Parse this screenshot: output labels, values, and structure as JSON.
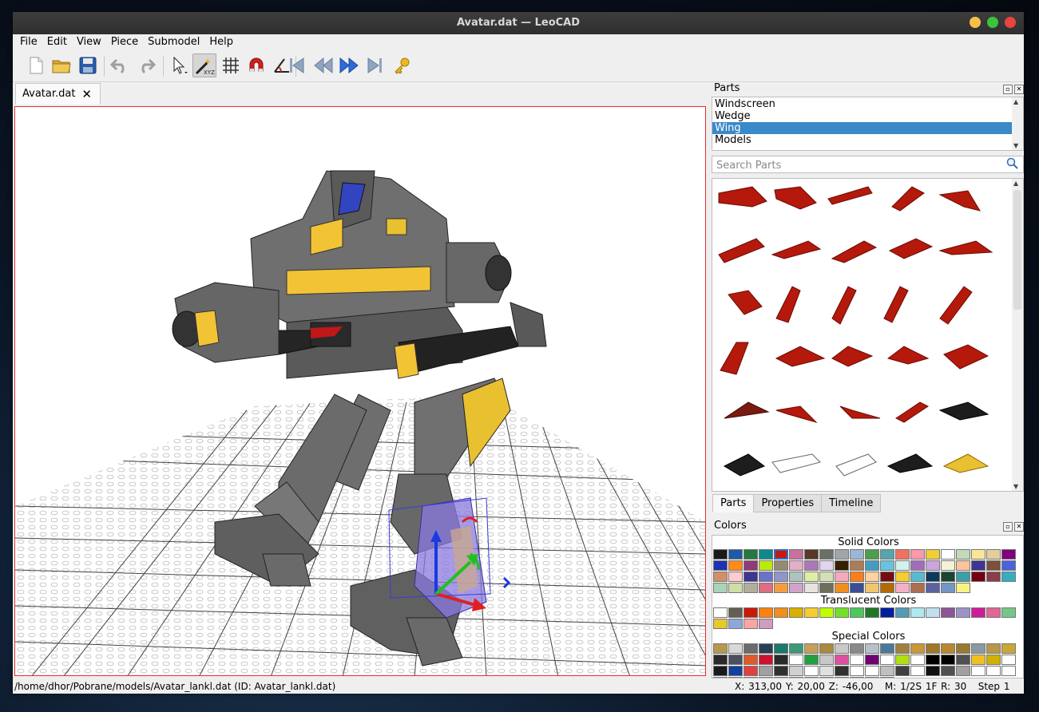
{
  "window": {
    "title": "Avatar.dat — LeoCAD"
  },
  "menu": [
    "File",
    "Edit",
    "View",
    "Piece",
    "Submodel",
    "Help"
  ],
  "toolbar": {
    "buttons": [
      "new-file-icon",
      "open-folder-icon",
      "save-icon",
      "undo-icon",
      "redo-icon",
      "select-tool-icon",
      "transform-tool-icon",
      "grid-snap-icon",
      "magnet-snap-icon",
      "angle-snap-icon",
      "first-step-icon",
      "previous-step-icon",
      "next-step-icon",
      "last-step-icon",
      "key-icon"
    ]
  },
  "document_tab": {
    "label": "Avatar.dat"
  },
  "parts_panel": {
    "title": "Parts",
    "categories": [
      "Windscreen",
      "Wedge",
      "Wing",
      "Models"
    ],
    "selected_category": "Wing",
    "search_placeholder": "Search Parts",
    "tabs": [
      "Parts",
      "Properties",
      "Timeline"
    ],
    "active_tab": "Parts"
  },
  "colors_panel": {
    "title": "Colors",
    "solid_title": "Solid Colors",
    "translucent_title": "Translucent Colors",
    "special_title": "Special Colors",
    "solid_colors": [
      "#1a1a1a",
      "#1e5aa8",
      "#237841",
      "#0a8a8f",
      "#c91a09",
      "#c870a0",
      "#583927",
      "#6c6e68",
      "#a0a5a9",
      "#9bb7d8",
      "#4b9f4a",
      "#55a5af",
      "#f2705e",
      "#fc97ac",
      "#f2cd37",
      "#ffffff",
      "#c2dab8",
      "#fbe696",
      "#e4cd9e",
      "#81007b",
      "#2032b0",
      "#fe8a18",
      "#923978",
      "#bbe90b",
      "#958a73",
      "#e4adc8",
      "#ac78ba",
      "#e1d5ed",
      "#352100",
      "#aa7d55",
      "#469bc3",
      "#68c3e2",
      "#d3f2ea",
      "#a06eb9",
      "#cda4de",
      "#f5f3d7",
      "#fcc39e",
      "#3f3691",
      "#7c503a",
      "#4c61db",
      "#d09168",
      "#feccce",
      "#3f3691",
      "#6874ca",
      "#9195ca",
      "#adc3c0",
      "#dfeea5",
      "#d3e0b6",
      "#f6a9bb",
      "#fc7e1b",
      "#fcd2a0",
      "#720e0f",
      "#f5cd2f",
      "#59b9d1",
      "#0b3a5e",
      "#184632",
      "#3d9ea7",
      "#720012",
      "#8b3d4a",
      "#36aebf",
      "#aad4b8",
      "#d0dda3",
      "#b1ae9e",
      "#e16d82",
      "#f49c3e",
      "#d1a3c9",
      "#e6e3e0",
      "#6d6e5c",
      "#f08f1c",
      "#3a4d96",
      "#f0c66e",
      "#b46a00",
      "#f4b0c6",
      "#ab6f4e",
      "#5b61a1",
      "#7396c8",
      "#f8f184"
    ],
    "translucent_colors": [
      "#ffffff",
      "#635f52",
      "#c91a09",
      "#ff800d",
      "#f08f1c",
      "#dab000",
      "#f5cd2f",
      "#c0ff00",
      "#73e02b",
      "#4cc85a",
      "#217625",
      "#0020a0",
      "#559ab7",
      "#aee9ef",
      "#c1dff0",
      "#8e5597",
      "#9b94c9",
      "#ce1d9b",
      "#df6695",
      "#76c787",
      "#e6c92a",
      "#8ba8d9",
      "#fca4a4",
      "#d09cc3"
    ],
    "special_colors": [
      "#b59a4e",
      "#d9d9d9",
      "#6b6b6b",
      "#2a3f55",
      "#1a7a6a",
      "#3a9a7a",
      "#c5a05a",
      "#a88a40",
      "#c9c9c9",
      "#8a8a8a",
      "#b8c0c8",
      "#4a7a9a",
      "#a08040",
      "#c89838",
      "#a07828",
      "#b88830",
      "#9a7a30",
      "#8a9aa0",
      "#b89848",
      "#c8a838",
      "#2a2a2a",
      "#4a5060",
      "#e05a2a",
      "#d01030",
      "#2a2a2a",
      "#ffffff",
      "#20a040",
      "#c8c8c8",
      "#e050a0",
      "#ffffff",
      "#700070",
      "#ffffff",
      "#b0e010",
      "#ffffff",
      "#000000",
      "#000000",
      "#505050",
      "#f0c020",
      "#d0b000",
      "#ffffff",
      "#1a1a1a",
      "#1040a0",
      "#e04040",
      "#a0a0a0",
      "#303030",
      "#d0d0d0",
      "#ffffff",
      "#e0e0e0",
      "#303030",
      "#ffffff",
      "#ffffff",
      "#c0c0c0",
      "#404040",
      "#ffffff",
      "#101010",
      "#505050",
      "#a0a0a0",
      "#ffffff",
      "#ffffff",
      "#ffffff",
      "#c0a0e0",
      "#40a0a0",
      "#2050a0",
      "#d0d0d0",
      "#ffffff",
      "#ffffff",
      "#303030",
      "#606060",
      "#e0e080",
      "#d0d0d0",
      "#2060c0",
      "#ffffff"
    ]
  },
  "status": {
    "path": "/home/dhor/Pobrane/models/Avatar_lankl.dat (ID: Avatar_lankl.dat)",
    "coords": "X: 313,00 Y: 20,00 Z: -46,00",
    "info": "M: 1/2S 1F R: 30",
    "step": "Step 1"
  },
  "colors_ui": {
    "accent_selection": "#3a89c9",
    "viewport_border": "#e03030"
  }
}
